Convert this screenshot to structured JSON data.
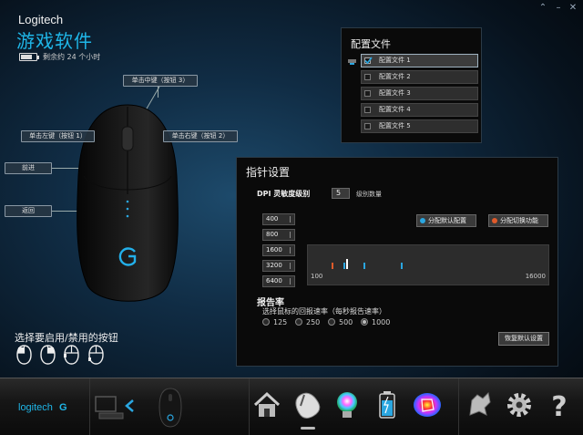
{
  "header": {
    "brand": "Logitech",
    "app_title": "游戏软件",
    "battery_text": "剩余约 24 个小时",
    "battery_level": 0.75,
    "window_controls": [
      "⌃",
      "–",
      "✕"
    ]
  },
  "mouse_buttons": {
    "middle": "单击中键（按钮 3）",
    "left": "单击左键（按钮 1）",
    "right": "单击右键（按钮 2）",
    "forward": "前进",
    "back": "返回"
  },
  "button_toggle_caption": "选择要启用/禁用的按钮",
  "profiles": {
    "title": "配置文件",
    "items": [
      {
        "label": "配置文件 1",
        "checked": true,
        "active": true
      },
      {
        "label": "配置文件 2",
        "checked": false,
        "active": false
      },
      {
        "label": "配置文件 3",
        "checked": false,
        "active": false
      },
      {
        "label": "配置文件 4",
        "checked": false,
        "active": false
      },
      {
        "label": "配置文件 5",
        "checked": false,
        "active": false
      }
    ]
  },
  "pointer": {
    "title": "指针设置",
    "dpi_levels_label": "DPI 灵敏度级别",
    "dpi_count": "5",
    "dpi_count_unit": "级别数量",
    "dpi_values": [
      "400",
      "800",
      "1600",
      "3200",
      "6400"
    ],
    "assign_default": "分配默认配置",
    "assign_shift": "分配切换功能",
    "slider_min": "100",
    "slider_max": "16000",
    "report_rate_title": "报告率",
    "report_rate_sub": "选择鼠标的回报速率（每秒报告速率）",
    "rates": [
      "125",
      "250",
      "500",
      "1000"
    ],
    "selected_rate": "1000",
    "restore_default": "恢复默认设置"
  },
  "bottombar": {
    "logo": "logitech"
  },
  "colors": {
    "accent": "#1fb6e8",
    "dpi_tick": "#2aa6e0",
    "default_marker": "#e05a2a"
  }
}
